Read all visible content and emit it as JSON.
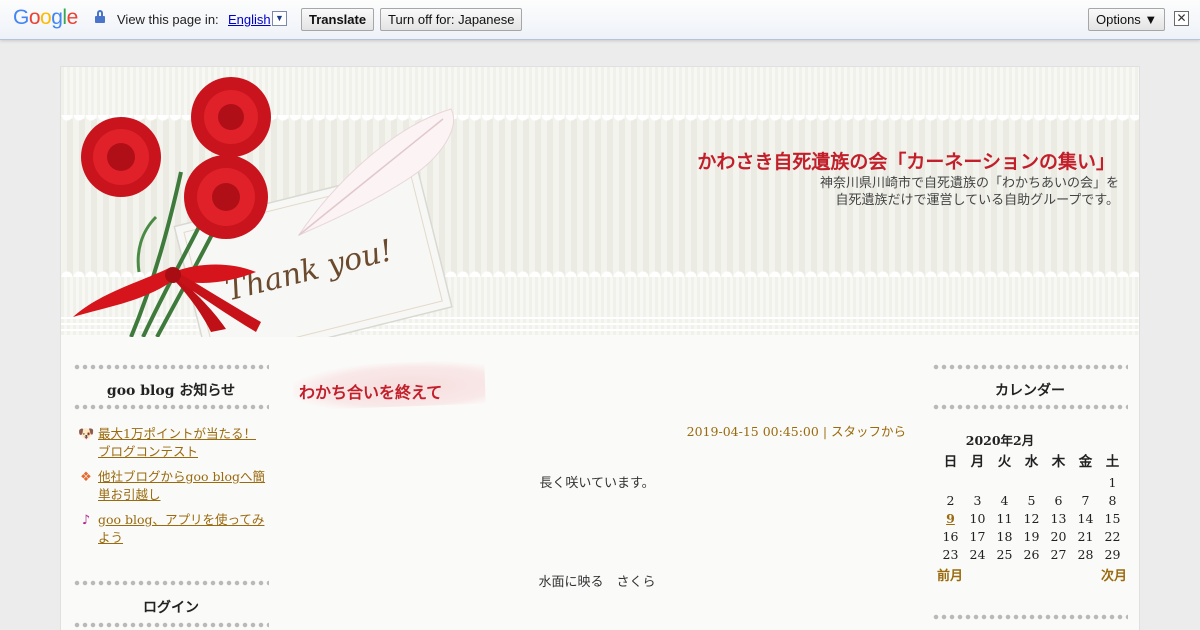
{
  "translate_bar": {
    "logo": "Google",
    "view_label": "View this page in:",
    "language": "English",
    "language_arrow": "▼",
    "translate_button": "Translate",
    "turn_off_button": "Turn off for: Japanese",
    "options_button": "Options ▼",
    "close_glyph": "✕",
    "logo_colors": [
      "#4285f4",
      "#ea4335",
      "#fbbc05",
      "#4285f4",
      "#34a853",
      "#ea4335"
    ]
  },
  "header": {
    "site_title": "かわさき自死遺族の会「カーネーションの集い」",
    "description_line1": "神奈川県川崎市で自死遺族の「わかちあいの会」を",
    "description_line2": "自死遺族だけで運営している自助グループです。",
    "image_text": "Thank you!"
  },
  "left_sidebar": {
    "notices_title": "goo blog お知らせ",
    "notices": [
      {
        "icon": "dog-face-icon",
        "label": "最大1万ポイントが当たる！ブログコンテスト"
      },
      {
        "icon": "diamond-flower-icon",
        "label": "他社ブログからgoo blogへ簡単お引越し"
      },
      {
        "icon": "music-note-icon",
        "label": "goo blog、アプリを使ってみよう"
      }
    ],
    "login_title": "ログイン"
  },
  "entry": {
    "title": "わかち合いを終えて",
    "meta": "2019-04-15 00:45:00 | スタッフから",
    "body_line1": "長く咲いています。",
    "body_line2": "水面に映る　さくら"
  },
  "calendar": {
    "title": "カレンダー",
    "month": "2020年2月",
    "weekdays": [
      "日",
      "月",
      "火",
      "水",
      "木",
      "金",
      "土"
    ],
    "weeks": [
      [
        "",
        "",
        "",
        "",
        "",
        "",
        "1"
      ],
      [
        "2",
        "3",
        "4",
        "5",
        "6",
        "7",
        "8"
      ],
      [
        "9",
        "10",
        "11",
        "12",
        "13",
        "14",
        "15"
      ],
      [
        "16",
        "17",
        "18",
        "19",
        "20",
        "21",
        "22"
      ],
      [
        "23",
        "24",
        "25",
        "26",
        "27",
        "28",
        "29"
      ]
    ],
    "linked_day": "9",
    "prev": "前月",
    "next": "次月"
  },
  "colors": {
    "title_red": "#c21f2a",
    "link_gold": "#9a6a0e"
  }
}
